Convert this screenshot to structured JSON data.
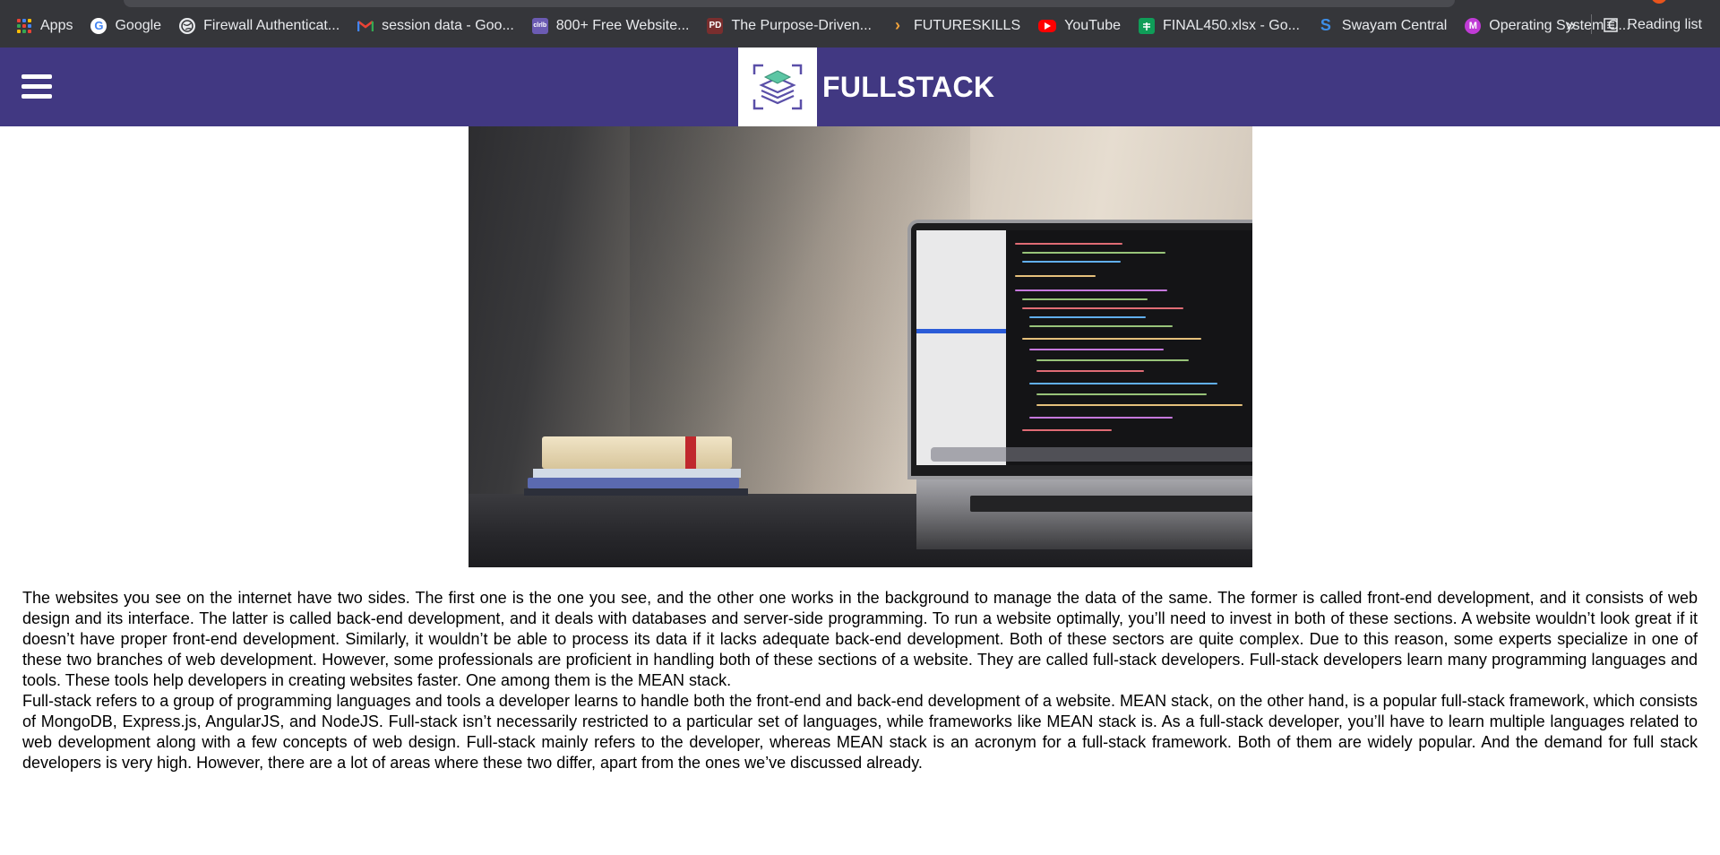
{
  "bookmarks": [
    {
      "label": "Apps",
      "icon": "apps-grid-icon"
    },
    {
      "label": "Google",
      "icon": "google-icon"
    },
    {
      "label": "Firewall Authenticat...",
      "icon": "globe-icon"
    },
    {
      "label": "session data - Goo...",
      "icon": "gmail-icon"
    },
    {
      "label": "800+ Free Website...",
      "icon": "colorlib-icon"
    },
    {
      "label": "The Purpose-Driven...",
      "icon": "book-icon"
    },
    {
      "label": "FUTURESKILLS",
      "icon": "chevron-right-icon"
    },
    {
      "label": "YouTube",
      "icon": "youtube-icon"
    },
    {
      "label": "FINAL450.xlsx - Go...",
      "icon": "sheets-icon"
    },
    {
      "label": "Swayam Central",
      "icon": "swayam-icon"
    },
    {
      "label": "Operating System C...",
      "icon": "m-icon"
    }
  ],
  "bookmarks_more": "»",
  "reading_list": "Reading list",
  "header": {
    "brand": "FULLSTACK",
    "menu_icon": "hamburger-menu-icon",
    "logo_icon": "stacked-layers-logo-icon",
    "background_color": "#413882"
  },
  "article": {
    "paragraph_1": "The websites you see on the internet have two sides. The first one is the one you see, and the other one works in the background to manage the data of the same. The former is called front-end development, and it consists of web design and its interface. The latter is called back-end development, and it deals with databases and server-side programming. To run a website optimally, you’ll need to invest in both of these sections. A website wouldn’t look great if it doesn’t have proper front-end development. Similarly, it wouldn’t be able to process its data if it lacks adequate back-end development. Both of these sectors are quite complex. Due to this reason, some experts specialize in one of these two branches of web development. However, some professionals are proficient in handling both of these sections of a website. They are called full-stack developers. Full-stack developers learn many programming languages and tools. These tools help developers in creating websites faster. One among them is the MEAN stack.",
    "paragraph_2": "Full-stack refers to a group of programming languages and tools a developer learns to handle both the front-end and back-end development of a website. MEAN stack, on the other hand, is a popular full-stack framework, which consists of MongoDB, Express.js, AngularJS, and NodeJS. Full-stack isn’t necessarily restricted to a particular set of languages, while frameworks like MEAN stack is. As a full-stack developer, you’ll have to learn multiple languages related to web development along with a few concepts of web design. Full-stack mainly refers to the developer, whereas MEAN stack is an acronym for a full-stack framework. Both of them are widely popular. And the demand for full stack developers is very high. However, there are a lot of areas where these two differ, apart from the ones we’ve discussed already."
  }
}
